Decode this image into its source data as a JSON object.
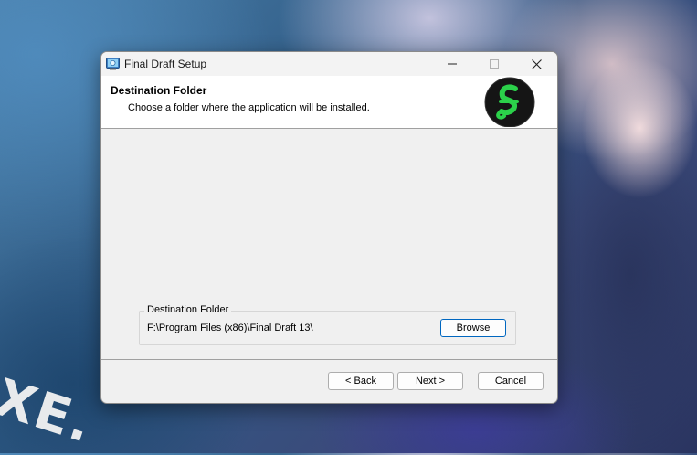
{
  "window": {
    "title": "Final Draft Setup"
  },
  "header": {
    "title": "Destination Folder",
    "subtitle": "Choose a folder where the application will be installed."
  },
  "destination": {
    "group_label": "Destination Folder",
    "path": "F:\\Program Files (x86)\\Final Draft 13\\",
    "browse_label": "Browse"
  },
  "footer": {
    "back_label": "< Back",
    "next_label": "Next >",
    "cancel_label": "Cancel"
  },
  "colors": {
    "logo_green": "#2bd14a",
    "logo_bg": "#111111",
    "focus_border": "#0067c0"
  },
  "icons": {
    "app": "installer-icon",
    "logo": "final-draft-logo-icon",
    "minimize": "minimize-icon",
    "maximize": "maximize-icon",
    "close": "close-icon"
  }
}
